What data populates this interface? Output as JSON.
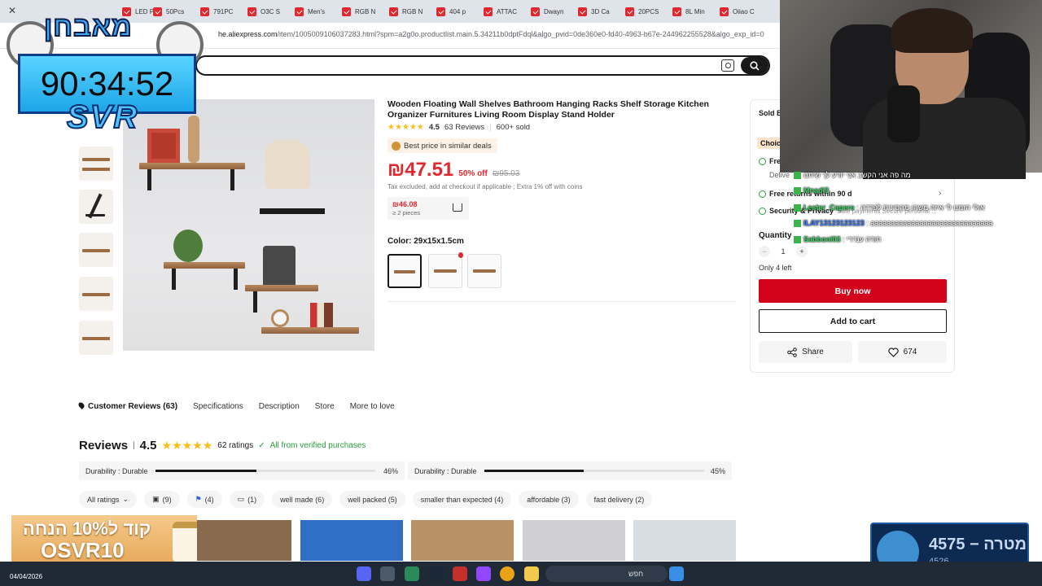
{
  "browser": {
    "tabs": [
      {
        "label": "LED Pl..."
      },
      {
        "label": "50Pcs"
      },
      {
        "label": "791PC"
      },
      {
        "label": "O3C S"
      },
      {
        "label": "Men's"
      },
      {
        "label": "RGB N"
      },
      {
        "label": "RGB N"
      },
      {
        "label": "404 p"
      },
      {
        "label": "ATTAC"
      },
      {
        "label": "Dwayn"
      },
      {
        "label": "3D Ca"
      },
      {
        "label": "20PCS"
      },
      {
        "label": "8L Min"
      },
      {
        "label": "Oiiao C"
      }
    ],
    "url_domain": "he.aliexpress.com",
    "url_path": "/item/1005009106037283.html?spm=a2g0o.productlist.main.5.34211b0dptFdql&algo_pvid=0de360e0-fd40-4963-b67e-244962255528&algo_exp_id=0"
  },
  "product": {
    "title": "Wooden Floating Wall Shelves Bathroom Hanging Racks Shelf Storage Kitchen Organizer Furnitures Living Room Display Stand Holder",
    "rating": "4.5",
    "reviews": "63 Reviews",
    "sold": "600+ sold",
    "best_price": "Best price in similar deals",
    "price": "₪47.51",
    "discount": "50% off",
    "old_price": "₪95.03",
    "tax_note": "Tax excluded, add at checkout if applicable ; Extra 1% off with coins",
    "bulk_price": "₪46.08",
    "bulk_qty": "≥ 2 pieces",
    "color_label": "Color: 29x15x1.5cm"
  },
  "card": {
    "sold_by": "Sold B",
    "choice": "Choic",
    "free_ship": "Fre",
    "delivery": "Delive",
    "free_returns": "Free returns within 90 d",
    "security": "Security & Privacy",
    "security_sub": "Safe payments Secure personal ...",
    "quantity_label": "Quantity",
    "qty_value": "1",
    "minus": "−",
    "plus": "+",
    "stock": "Only 4 left",
    "buy_now": "Buy now",
    "add_to_cart": "Add to cart",
    "share": "Share",
    "likes": "674"
  },
  "tabs": {
    "customer_reviews": "Customer Reviews (63)",
    "specifications": "Specifications",
    "description": "Description",
    "store": "Store",
    "more": "More to love"
  },
  "reviews": {
    "heading": "Reviews",
    "sep": "|",
    "score": "4.5",
    "ratings": "62 ratings",
    "verified": "All from verified purchases",
    "bars": [
      {
        "label": "Durability : Durable",
        "pct": "46%",
        "value": 0.46
      },
      {
        "label": "Durability : Durable",
        "pct": "45%",
        "value": 0.45
      }
    ],
    "filters": {
      "all": "All ratings",
      "photos": "(9)",
      "local": "(4)",
      "comments": "(1)",
      "chips": [
        "well made (6)",
        "well packed (5)",
        "smaller than expected (4)",
        "affordable (3)",
        "fast delivery (2)"
      ]
    }
  },
  "overlay": {
    "logo": "מאבחן",
    "timer": "90:34:52",
    "brand": "SVR",
    "chat": [
      {
        "name": "",
        "msg": "מה פה אני הקשב אני יודע לך שיתנו"
      },
      {
        "name": "Mnadl3",
        "msg": ""
      },
      {
        "name": "Lester_Capere",
        "msg": "אולי הזמנו לי איזה משהו מהסינית לפדדה"
      },
      {
        "name": "ILAY13123123123",
        "msg": "aaaaaaaaaaaaaaaaaaaaaaaaaaaaaa"
      },
      {
        "name": "Sabbonl03",
        "msg": "תודה ענדרי"
      }
    ],
    "promo_line1": "קוד ל10% הנחה",
    "promo_code": "OSVR10",
    "goal_title": "4575 − מטרה",
    "goal_sub": "4526"
  },
  "taskbar": {
    "date": "04/04/2026",
    "search": "חפש"
  }
}
